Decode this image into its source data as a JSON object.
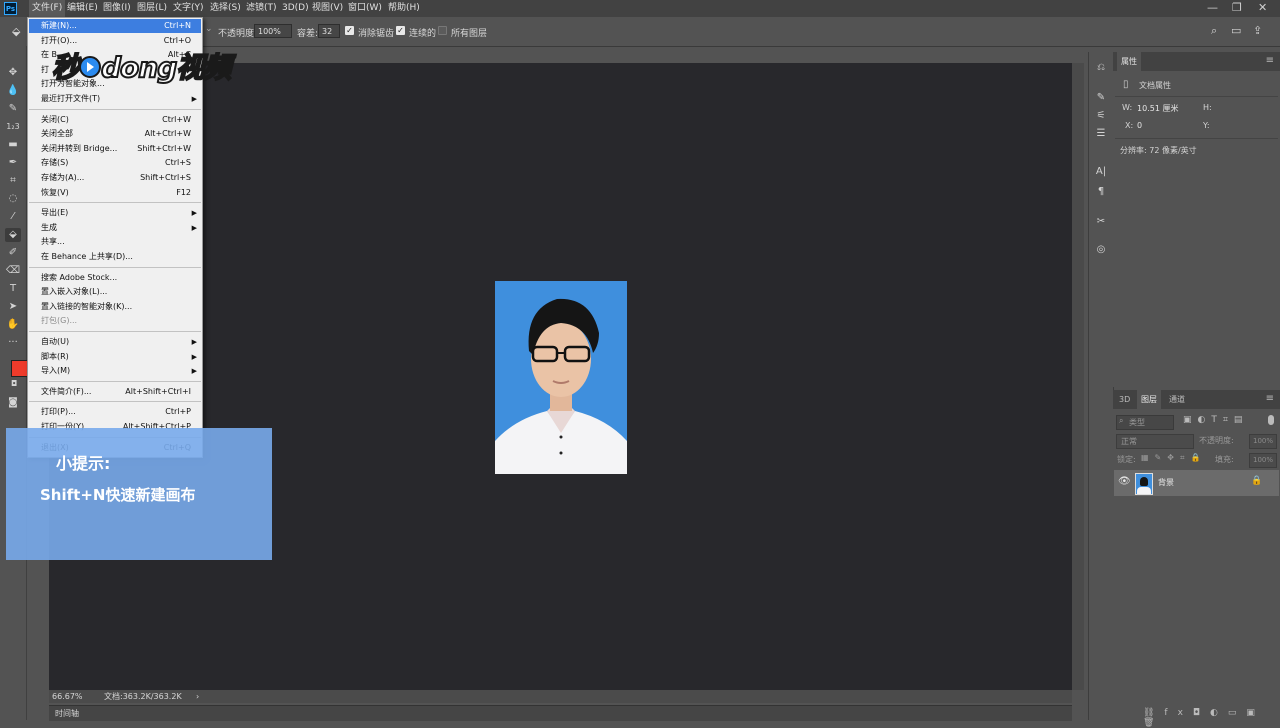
{
  "menubar": {
    "app_icon": "Ps",
    "items": [
      "文件(F)",
      "编辑(E)",
      "图像(I)",
      "图层(L)",
      "文字(Y)",
      "选择(S)",
      "滤镜(T)",
      "3D(D)",
      "视图(V)",
      "窗口(W)",
      "帮助(H)"
    ]
  },
  "options_bar": {
    "opacity_label": "不透明度:",
    "opacity_value": "100%",
    "tolerance_label": "容差:",
    "tolerance_value": "32",
    "antialias_label": "消除锯齿",
    "contiguous_label": "连续的",
    "all_layers_label": "所有图层"
  },
  "file_menu": {
    "groups": [
      [
        {
          "label": "新建(N)...",
          "shortcut": "Ctrl+N",
          "highlighted": true
        },
        {
          "label": "打开(O)...",
          "shortcut": "Ctrl+O"
        },
        {
          "label": "在 B",
          "shortcut": "Alt+C"
        },
        {
          "label": "打",
          "shortcut": ""
        },
        {
          "label": "打开为智能对象...",
          "shortcut": ""
        },
        {
          "label": "最近打开文件(T)",
          "shortcut": "",
          "submenu": true
        }
      ],
      [
        {
          "label": "关闭(C)",
          "shortcut": "Ctrl+W"
        },
        {
          "label": "关闭全部",
          "shortcut": "Alt+Ctrl+W"
        },
        {
          "label": "关闭并转到 Bridge...",
          "shortcut": "Shift+Ctrl+W"
        },
        {
          "label": "存储(S)",
          "shortcut": "Ctrl+S"
        },
        {
          "label": "存储为(A)...",
          "shortcut": "Shift+Ctrl+S"
        },
        {
          "label": "恢复(V)",
          "shortcut": "F12"
        }
      ],
      [
        {
          "label": "导出(E)",
          "shortcut": "",
          "submenu": true
        },
        {
          "label": "生成",
          "shortcut": "",
          "submenu": true
        },
        {
          "label": "共享...",
          "shortcut": ""
        },
        {
          "label": "在 Behance 上共享(D)...",
          "shortcut": ""
        }
      ],
      [
        {
          "label": "搜索 Adobe Stock...",
          "shortcut": ""
        },
        {
          "label": "置入嵌入对象(L)...",
          "shortcut": ""
        },
        {
          "label": "置入链接的智能对象(K)...",
          "shortcut": ""
        },
        {
          "label": "打包(G)...",
          "shortcut": "",
          "disabled": true
        }
      ],
      [
        {
          "label": "自动(U)",
          "shortcut": "",
          "submenu": true
        },
        {
          "label": "脚本(R)",
          "shortcut": "",
          "submenu": true
        },
        {
          "label": "导入(M)",
          "shortcut": "",
          "submenu": true
        }
      ],
      [
        {
          "label": "文件简介(F)...",
          "shortcut": "Alt+Shift+Ctrl+I"
        }
      ],
      [
        {
          "label": "打印(P)...",
          "shortcut": "Ctrl+P"
        },
        {
          "label": "打印一份(Y)",
          "shortcut": "Alt+Shift+Ctrl+P"
        }
      ],
      [
        {
          "label": "退出(X)",
          "shortcut": "Ctrl+Q"
        }
      ]
    ]
  },
  "status": {
    "zoom": "66.67%",
    "doc_size": "文档:363.2K/363.2K",
    "timeline_tab": "时间轴"
  },
  "properties_panel": {
    "tab": "属性",
    "section": "文档属性",
    "w_label": "W:",
    "w_value": "10.51 厘米",
    "h_label": "H:",
    "x_label": "X:",
    "x_value": "0",
    "y_label": "Y:",
    "resolution": "分辨率: 72 像素/英寸"
  },
  "layers_panel": {
    "tabs": [
      "3D",
      "图层",
      "通道"
    ],
    "active_tab": "图层",
    "filter_placeholder": "类型",
    "blend_mode": "正常",
    "opacity_label": "不透明度:",
    "opacity_value": "100%",
    "lock_label": "锁定:",
    "fill_label": "填充:",
    "fill_value": "100%",
    "layer_name": "背景"
  },
  "tip": {
    "title": "小提示:",
    "body": "Shift+N快速新建画布"
  },
  "watermark": {
    "text_a": "秒",
    "text_b": "dong视频"
  },
  "colors": {
    "accent": "#3d7ee0",
    "foreground_swatch": "#ee3b2b",
    "canvas_bg": "#28282c",
    "photo_bg": "#3f8fdd"
  }
}
